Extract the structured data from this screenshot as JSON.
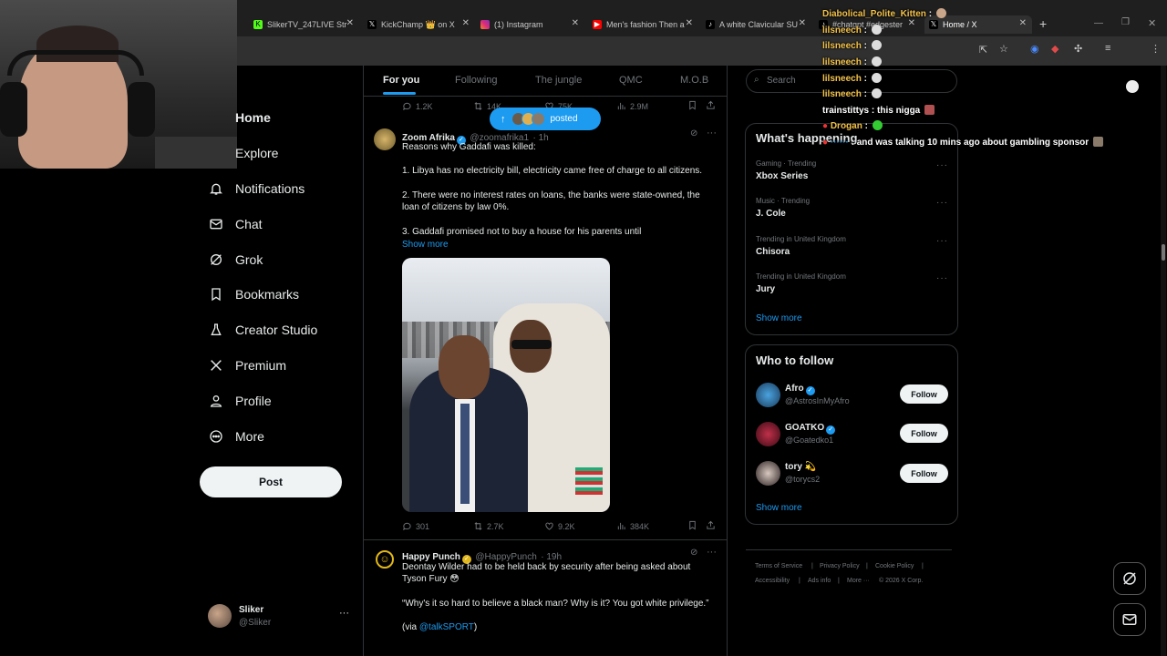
{
  "browser": {
    "tabs": [
      {
        "title": "SlikerTV_247LIVE Str",
        "icon": "kick-icon",
        "color": "#53fc18"
      },
      {
        "title": "KickChamp 👑 on X",
        "icon": "x-icon",
        "color": "#000000"
      },
      {
        "title": "(1) Instagram",
        "icon": "instagram-icon",
        "color": "#e1306c"
      },
      {
        "title": "Men's fashion Then a",
        "icon": "youtube-icon",
        "color": "#ff0000"
      },
      {
        "title": "A white Clavicular SU",
        "icon": "tiktok-icon",
        "color": "#000000"
      },
      {
        "title": "#chatgpt #edgester",
        "icon": "tiktok-icon",
        "color": "#000000"
      },
      {
        "title": "Home / X",
        "icon": "x-icon",
        "color": "#000000"
      }
    ],
    "new_tab": "+"
  },
  "nav": {
    "items": [
      {
        "label": "Home",
        "icon": "home-icon"
      },
      {
        "label": "Explore",
        "icon": "search-icon"
      },
      {
        "label": "Notifications",
        "icon": "bell-icon"
      },
      {
        "label": "Chat",
        "icon": "envelope-icon"
      },
      {
        "label": "Grok",
        "icon": "grok-icon"
      },
      {
        "label": "Bookmarks",
        "icon": "bookmark-icon"
      },
      {
        "label": "Creator Studio",
        "icon": "creator-studio-icon"
      },
      {
        "label": "Premium",
        "icon": "x-logo-icon"
      },
      {
        "label": "Profile",
        "icon": "person-icon"
      },
      {
        "label": "More",
        "icon": "more-circle-icon"
      }
    ],
    "post_label": "Post",
    "account": {
      "name": "Sliker",
      "handle": "@Sliker",
      "more": "···"
    }
  },
  "feed": {
    "tabs": [
      "For you",
      "Following",
      "The jungle",
      "QMC",
      "M.O.B"
    ],
    "posted_pill": "posted",
    "top_actions": {
      "replies": "1.2K",
      "reposts": "14K",
      "likes": "75K",
      "views": "2.9M"
    },
    "tweets": [
      {
        "name": "Zoom Afrika",
        "handle": "@zoomafrika1",
        "time": "· 1h",
        "lines": [
          "Reasons why Gaddafi was killed:",
          "1. Libya has no electricity bill, electricity came free of charge to all citizens.",
          "2. There were no interest rates on loans, the banks were state-owned, the loan of citizens by law 0%.",
          "3. Gaddafi promised not to buy a house for his parents until"
        ],
        "show_more": "Show more",
        "actions": {
          "replies": "301",
          "reposts": "2.7K",
          "likes": "9.2K",
          "views": "384K"
        }
      },
      {
        "name": "Happy Punch",
        "handle": "@HappyPunch",
        "time": "· 19h",
        "lines": [
          "Deontay Wilder had to be held back by security after being asked about Tyson Fury 😳",
          "“Why's it so hard to believe a black man? Why is it? You got white privilege.”",
          "(via ",
          "@talkSPORT",
          ")"
        ]
      }
    ]
  },
  "right": {
    "search_placeholder": "Search",
    "happening_title": "What's happening",
    "trends": [
      {
        "category": "Gaming · Trending",
        "name": "Xbox Series"
      },
      {
        "category": "Music · Trending",
        "name": "J. Cole"
      },
      {
        "category": "Trending in United Kingdom",
        "name": "Chisora"
      },
      {
        "category": "Trending in United Kingdom",
        "name": "Jury"
      }
    ],
    "trends_show_more": "Show more",
    "who_to_follow_title": "Who to follow",
    "follow_suggestions": [
      {
        "name": "Afro",
        "handle": "@AstrosInMyAfro",
        "follow": "Follow"
      },
      {
        "name": "GOATKO",
        "handle": "@Goatedko1",
        "follow": "Follow"
      },
      {
        "name": "tory 💫",
        "handle": "@torycs2",
        "follow": "Follow"
      }
    ],
    "wtf_show_more": "Show more",
    "footer": [
      "Terms of Service",
      "|",
      "Privacy Policy",
      "|",
      "Cookie Policy",
      "|",
      "Accessibility",
      "|",
      "Ads info",
      "|",
      "More ···",
      "© 2026 X Corp."
    ]
  },
  "chat_overlay": [
    {
      "user": "Diabolical_Polite_Kitten",
      "msg": ""
    },
    {
      "user": "lilsneech",
      "msg": ""
    },
    {
      "user": "lilsneech",
      "msg": ""
    },
    {
      "user": "lilsneech",
      "msg": ""
    },
    {
      "user": "lilsneech",
      "msg": ""
    },
    {
      "user": "lilsneech",
      "msg": ""
    },
    {
      "user": "trainstittys",
      "msg": "this nigga"
    },
    {
      "user": "Drogan",
      "msg": ""
    },
    {
      "user": "",
      "msg": "and was talking 10 mins ago about gambling sponsor"
    }
  ]
}
